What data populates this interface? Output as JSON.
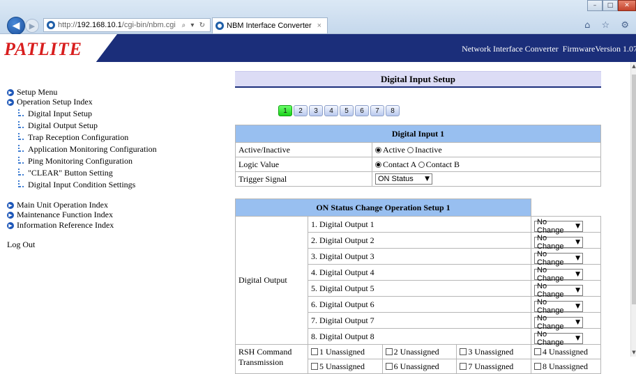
{
  "browser": {
    "url_prefix": "http://",
    "url_host": "192.168.10.1",
    "url_path": "/cgi-bin/nbm.cgi",
    "address_tools": "⌕ ▾ ↻",
    "tab_title": "NBM Interface Converter",
    "tab_close": "×",
    "window_buttons": [
      "–",
      "□",
      "✕"
    ],
    "toolbar_icons": "⌂ ☆ ⚙"
  },
  "header": {
    "logo": "PATLITE",
    "title": "Network Interface Converter",
    "firmware": "FirmwareVersion 1.07"
  },
  "sidebar": {
    "setup_menu": "Setup Menu",
    "operation_index": "Operation Setup Index",
    "sub_items": [
      "Digital Input Setup",
      "Digital Output Setup",
      "Trap Reception Configuration",
      "Application Monitoring Configuration",
      "Ping Monitoring Configuration",
      "\"CLEAR\" Button Setting",
      "Digital Input Condition Settings"
    ],
    "main_unit_index": "Main Unit Operation Index",
    "maintenance_index": "Maintenance Function Index",
    "information_index": "Information Reference Index",
    "logout": "Log Out"
  },
  "main": {
    "page_title": "Digital Input Setup",
    "pages": [
      "1",
      "2",
      "3",
      "4",
      "5",
      "6",
      "7",
      "8"
    ],
    "active_page": "1",
    "input_table": {
      "title": "Digital Input 1",
      "active_label": "Active/Inactive",
      "active_opt1": "Active",
      "active_opt2": "Inactive",
      "logic_label": "Logic Value",
      "logic_opt1": "Contact A",
      "logic_opt2": "Contact B",
      "trigger_label": "Trigger Signal",
      "trigger_value": "ON Status"
    },
    "on_table": {
      "title": "ON Status Change Operation Setup 1",
      "group_label": "Digital Output",
      "outputs": [
        {
          "name": "1. Digital Output 1",
          "value": "No Change"
        },
        {
          "name": "2. Digital Output 2",
          "value": "No Change"
        },
        {
          "name": "3. Digital Output 3",
          "value": "No Change"
        },
        {
          "name": "4. Digital Output 4",
          "value": "No Change"
        },
        {
          "name": "5. Digital Output 5",
          "value": "No Change"
        },
        {
          "name": "6. Digital Output 6",
          "value": "No Change"
        },
        {
          "name": "7. Digital Output 7",
          "value": "No Change"
        },
        {
          "name": "8. Digital Output 8",
          "value": "No Change"
        }
      ],
      "rsh_label": "RSH Command Transmission",
      "rsh_row1": [
        "1 Unassigned",
        "2 Unassigned",
        "3 Unassigned",
        "4 Unassigned"
      ],
      "rsh_row2": [
        "5 Unassigned",
        "6 Unassigned",
        "7 Unassigned",
        "8 Unassigned"
      ]
    }
  }
}
